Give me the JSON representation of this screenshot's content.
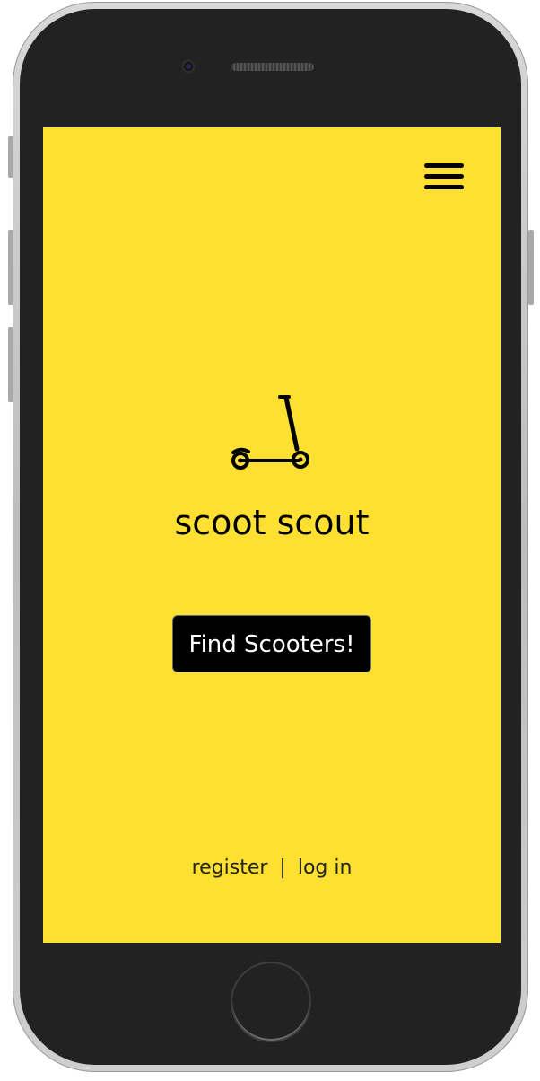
{
  "colors": {
    "screen_background": "#fde032",
    "button_background": "#000000",
    "button_text": "#ffffff",
    "frame": "#222222"
  },
  "header": {
    "menu_icon": "hamburger-menu-icon"
  },
  "hero": {
    "logo_icon": "kick-scooter-icon",
    "title": "scoot scout"
  },
  "cta": {
    "label": "Find Scooters!"
  },
  "footer": {
    "register_label": "register",
    "separator": "|",
    "login_label": "log in"
  }
}
